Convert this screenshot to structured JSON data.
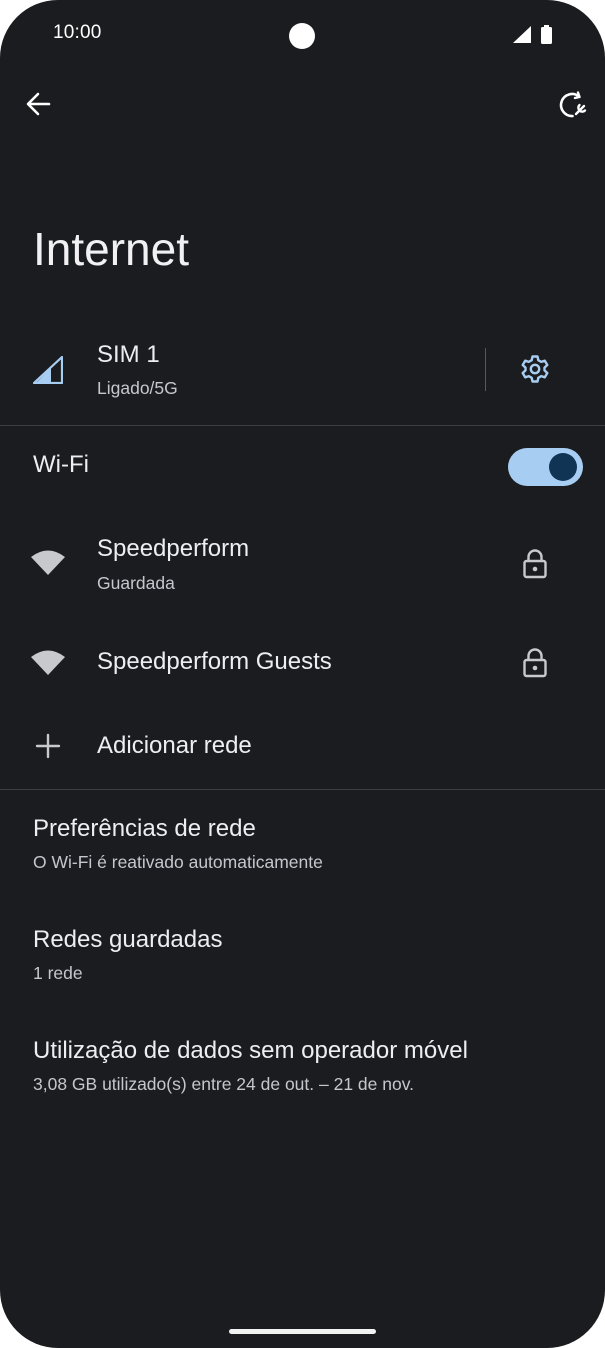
{
  "status_bar": {
    "time": "10:00",
    "icons": [
      "signal-icon",
      "battery-icon"
    ]
  },
  "toolbar": {
    "back_icon": "arrow-back-icon",
    "reset_icon": "network-reset-icon"
  },
  "page": {
    "title": "Internet"
  },
  "sim": {
    "title": "SIM 1",
    "subtitle": "Ligado/5G",
    "icon": "cell-signal-icon",
    "settings_icon": "gear-icon"
  },
  "wifi": {
    "label": "Wi-Fi",
    "enabled": true,
    "toggle_color": "#a8cdf2",
    "networks": [
      {
        "name": "Speedperform",
        "status": "Guardada",
        "icon": "wifi-icon",
        "secured_icon": "lock-icon"
      },
      {
        "name": "Speedperform Guests",
        "status": "",
        "icon": "wifi-icon",
        "secured_icon": "lock-icon"
      }
    ],
    "add_network": {
      "label": "Adicionar rede",
      "icon": "plus-icon"
    }
  },
  "settings": [
    {
      "title": "Preferências de rede",
      "subtitle": "O Wi-Fi é reativado automaticamente"
    },
    {
      "title": "Redes guardadas",
      "subtitle": "1 rede"
    },
    {
      "title": "Utilização de dados sem operador móvel",
      "subtitle": "3,08 GB utilizado(s) entre 24 de out. – 21 de nov."
    }
  ],
  "colors": {
    "background": "#1b1c1f",
    "accent": "#a8cdf2",
    "text_primary": "#eceef1",
    "text_secondary": "#c4c7cc"
  }
}
